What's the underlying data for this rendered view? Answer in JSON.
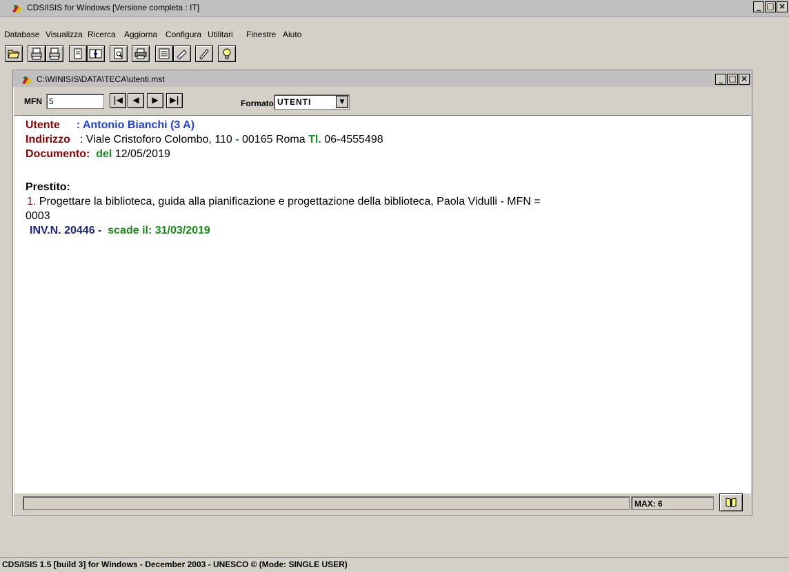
{
  "window": {
    "title": "CDS/ISIS for Windows [Versione completa : IT]",
    "icon": "cds-isis-icon"
  },
  "menu": [
    {
      "label": "Database"
    },
    {
      "label": "Visualizza"
    },
    {
      "label": "Ricerca"
    },
    {
      "label": "Aggiorna"
    },
    {
      "label": "Configura"
    },
    {
      "label": "Utilitari"
    },
    {
      "label": "Finestre"
    },
    {
      "label": "Aiuto"
    }
  ],
  "toolbar": [
    {
      "name": "open-folder-icon"
    },
    {
      "name": "print-txt-icon"
    },
    {
      "name": "print-rtf-icon"
    },
    {
      "name": "copy-icon"
    },
    {
      "name": "copy-database-icon"
    },
    {
      "name": "preview-icon"
    },
    {
      "name": "printer-icon"
    },
    {
      "name": "form-icon"
    },
    {
      "name": "edit-form-icon"
    },
    {
      "name": "pencil-icon"
    },
    {
      "name": "lightbulb-icon"
    }
  ],
  "child_window": {
    "title": "C:\\WINISIS\\DATA\\TECA\\utenti.mst"
  },
  "nav": {
    "mfn_label": "MFN",
    "mfn_value": "5",
    "format_label": "Formato:",
    "format_value": "UTENTI"
  },
  "record": {
    "utente_label": "Utente",
    "utente_value": ": Antonio Bianchi (3 A)",
    "indirizzo_label": "Indirizzo",
    "indirizzo_sep": ":",
    "indirizzo_value": "Viale Cristoforo Colombo, 110",
    "dash": "-",
    "cap_citta": "00165 Roma",
    "tel_label": "Tl.",
    "tel_value": "06-4555498",
    "documento_label": "Documento:",
    "del_label": "del",
    "documento_date": "12/05/2019",
    "prestito_label": "Prestito:",
    "loan_number": "1.",
    "loan_text_line1": "Progettare la biblioteca, guida alla pianificazione e progettazione della biblioteca, Paola Vidulli - MFN =",
    "loan_text_line2": "0003",
    "inv_label": "INV.N. 20446 -",
    "scadenza": "scade il: 31/03/2019"
  },
  "status": {
    "max_label": "MAX: 6"
  },
  "app_statusbar": "CDS/ISIS 1.5 [build 3] for Windows - December 2003 - UNESCO © (Mode: SINGLE USER)",
  "colors": {
    "label_red": "#8b0000",
    "value_blue": "#1f3fd8",
    "green": "#1a8a1a",
    "navy": "#1a237e"
  }
}
